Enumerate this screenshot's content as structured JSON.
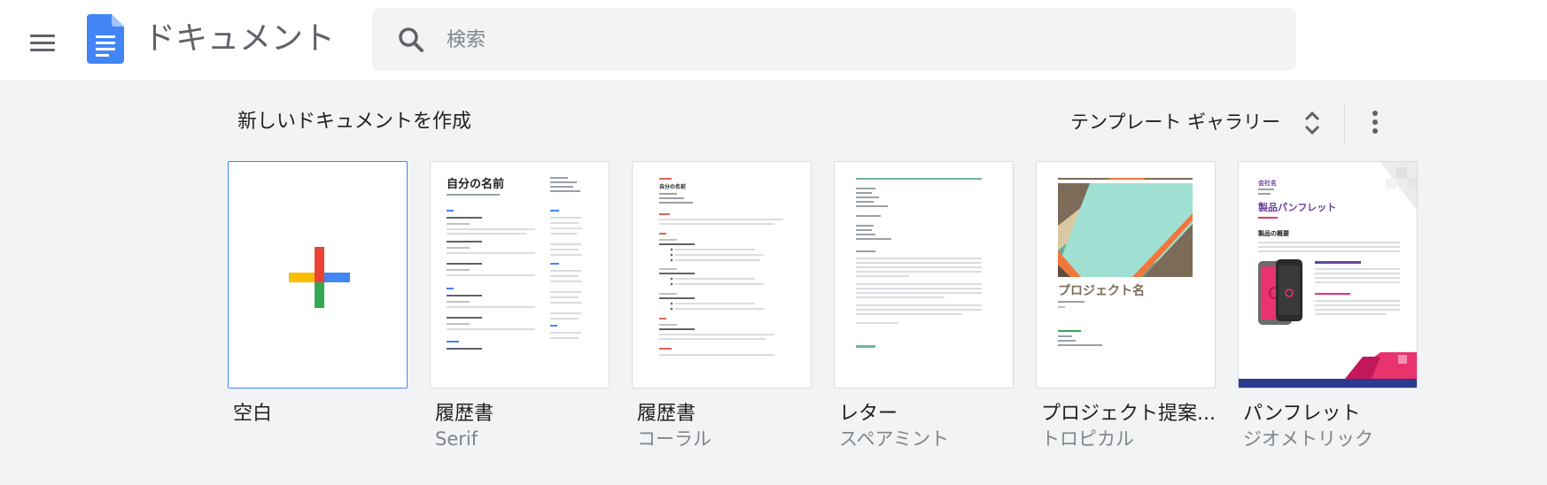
{
  "header": {
    "app_title": "ドキュメント",
    "search_placeholder": "検索",
    "menu_icon": "hamburger-menu-icon",
    "logo_icon": "google-docs-logo"
  },
  "templates_section": {
    "title": "新しいドキュメントを作成",
    "gallery_label": "テンプレート ギャラリー",
    "more_icon": "more-vert-icon"
  },
  "templates": [
    {
      "name": "空白",
      "subtitle": ""
    },
    {
      "name": "履歴書",
      "subtitle": "Serif"
    },
    {
      "name": "履歴書",
      "subtitle": "コーラル"
    },
    {
      "name": "レター",
      "subtitle": "スペアミント"
    },
    {
      "name": "プロジェクト提案...",
      "subtitle": "トロピカル"
    },
    {
      "name": "パンフレット",
      "subtitle": "ジオメトリック"
    }
  ],
  "thumbnail_text": {
    "resume_serif_name": "自分の名前",
    "resume_coral_name": "自分の名前",
    "project_title": "プロジェクト名",
    "brochure_company": "会社名",
    "brochure_title": "製品パンフレット",
    "brochure_overview": "製品の概要"
  },
  "colors": {
    "docs_blue": "#4285f4",
    "plus_red": "#ea4335",
    "plus_yellow": "#fbbc04",
    "plus_green": "#34a853",
    "coral": "#e06655",
    "spearmint": "#6fb5a0",
    "brochure_pink": "#e8336f",
    "brochure_navy": "#2b3a8c"
  }
}
